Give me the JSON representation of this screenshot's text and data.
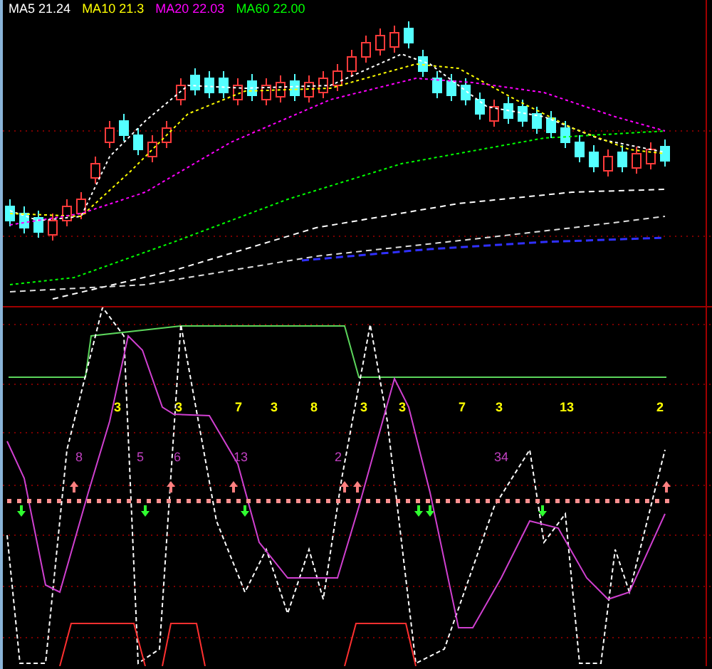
{
  "price_panel": {
    "legend": [
      {
        "label": "MA5",
        "value": "21.24",
        "color": "#ffffff"
      },
      {
        "label": "MA10",
        "value": "21.3",
        "color": "#ffff00"
      },
      {
        "label": "MA20",
        "value": "22.03",
        "color": "#ff00ff"
      },
      {
        "label": "MA60",
        "value": "22.00",
        "color": "#00ff00"
      }
    ]
  },
  "indicator_panel": {
    "upper_counts": [
      "3",
      "3",
      "7",
      "3",
      "8",
      "3",
      "3",
      "7",
      "3",
      "13",
      "2"
    ],
    "lower_counts": [
      "8",
      "5",
      "6",
      "13",
      "2",
      "34"
    ]
  }
}
